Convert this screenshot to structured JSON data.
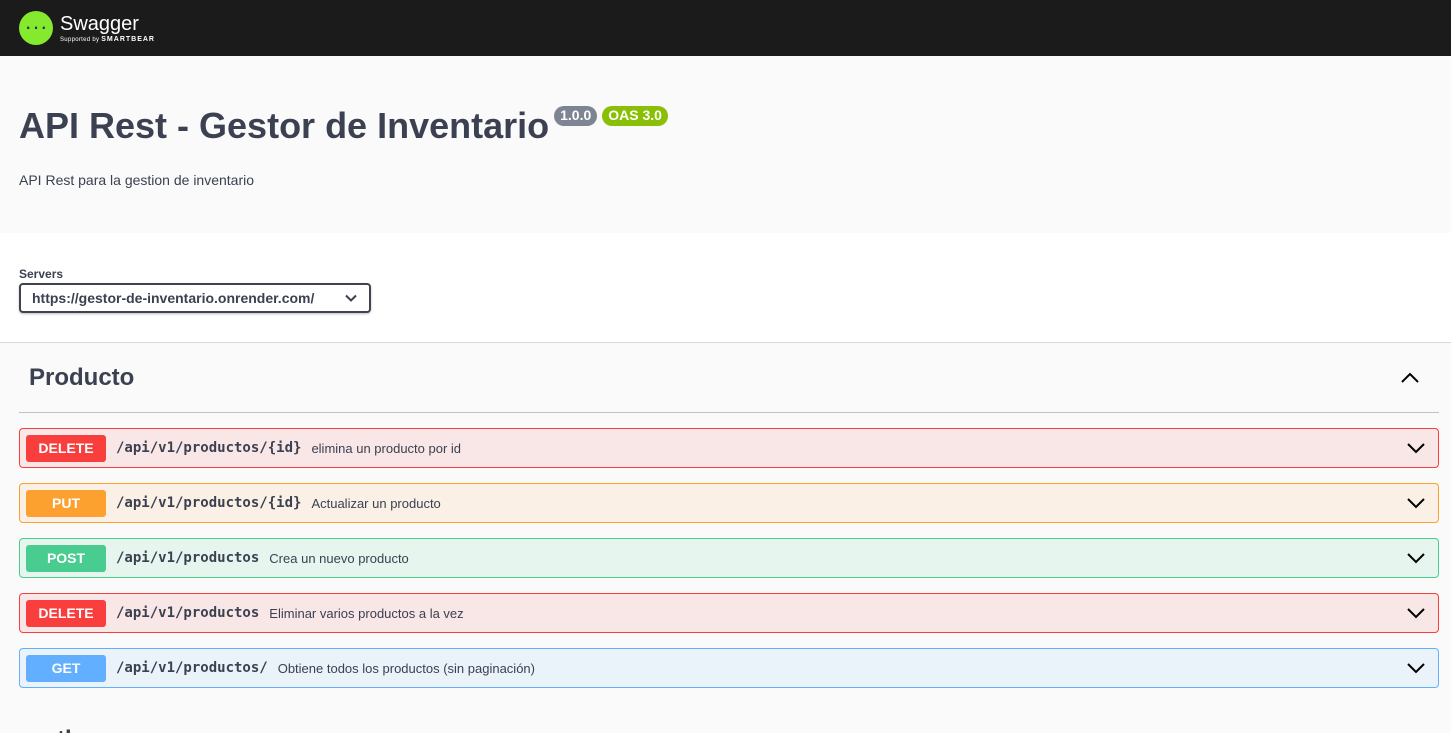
{
  "topbar": {
    "brand": "Swagger",
    "sub_prefix": "Supported by",
    "sub_brand": "SMARTBEAR"
  },
  "info": {
    "title": "API Rest - Gestor de Inventario",
    "version": "1.0.0",
    "oas": "OAS 3.0",
    "description": "API Rest para la gestion de inventario"
  },
  "servers": {
    "label": "Servers",
    "selected": "https://gestor-de-inventario.onrender.com/"
  },
  "tags": [
    {
      "name": "Producto",
      "operations": [
        {
          "method": "DELETE",
          "path": "/api/v1/productos/{id}",
          "summary": "elimina un producto por id"
        },
        {
          "method": "PUT",
          "path": "/api/v1/productos/{id}",
          "summary": "Actualizar un producto"
        },
        {
          "method": "POST",
          "path": "/api/v1/productos",
          "summary": "Crea un nuevo producto"
        },
        {
          "method": "DELETE",
          "path": "/api/v1/productos",
          "summary": "Eliminar varios productos a la vez"
        },
        {
          "method": "GET",
          "path": "/api/v1/productos/",
          "summary": "Obtiene todos los productos (sin paginación)"
        }
      ]
    },
    {
      "name": "auth",
      "operations": []
    }
  ],
  "colors": {
    "delete": "#f93e3e",
    "put": "#fca130",
    "post": "#49cc90",
    "get": "#61affe",
    "brand": "#85ea2d"
  }
}
